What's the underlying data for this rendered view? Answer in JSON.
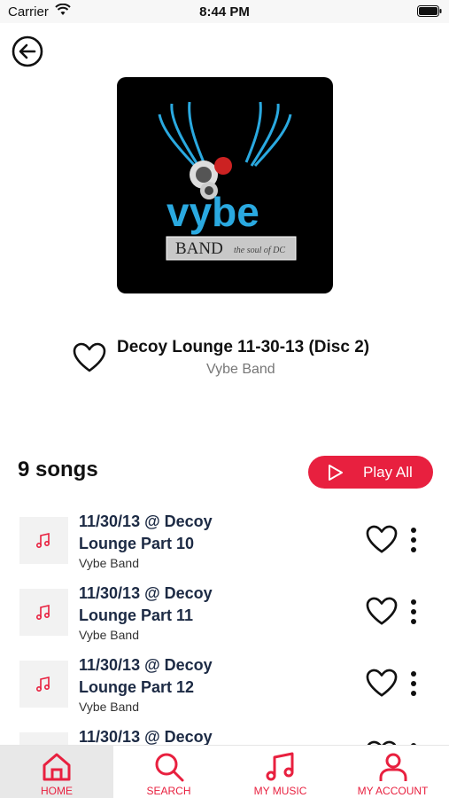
{
  "status_bar": {
    "carrier": "Carrier",
    "time": "8:44 PM"
  },
  "album": {
    "title": "Decoy Lounge 11-30-13 (Disc 2)",
    "artist": "Vybe Band",
    "cover_logo": {
      "main": "vybe",
      "badge": "BAND",
      "tagline": "the soul of DC"
    }
  },
  "songs_header": {
    "count_label": "9 songs",
    "play_all_label": "Play All"
  },
  "songs": [
    {
      "title": "11/30/13 @ Decoy Lounge Part 10",
      "artist": "Vybe Band"
    },
    {
      "title": "11/30/13 @ Decoy Lounge Part 11",
      "artist": "Vybe Band"
    },
    {
      "title": "11/30/13 @ Decoy Lounge Part 12",
      "artist": "Vybe Band"
    },
    {
      "title": "11/30/13 @ Decoy",
      "artist": ""
    }
  ],
  "tab_bar": [
    {
      "label": "HOME",
      "icon": "home-icon",
      "active": true
    },
    {
      "label": "SEARCH",
      "icon": "search-icon",
      "active": false
    },
    {
      "label": "MY MUSIC",
      "icon": "music-note-icon",
      "active": false
    },
    {
      "label": "MY ACCOUNT",
      "icon": "account-icon",
      "active": false
    }
  ],
  "colors": {
    "accent": "#e8203f",
    "song_title": "#1c2a44",
    "muted_text": "#777777"
  }
}
